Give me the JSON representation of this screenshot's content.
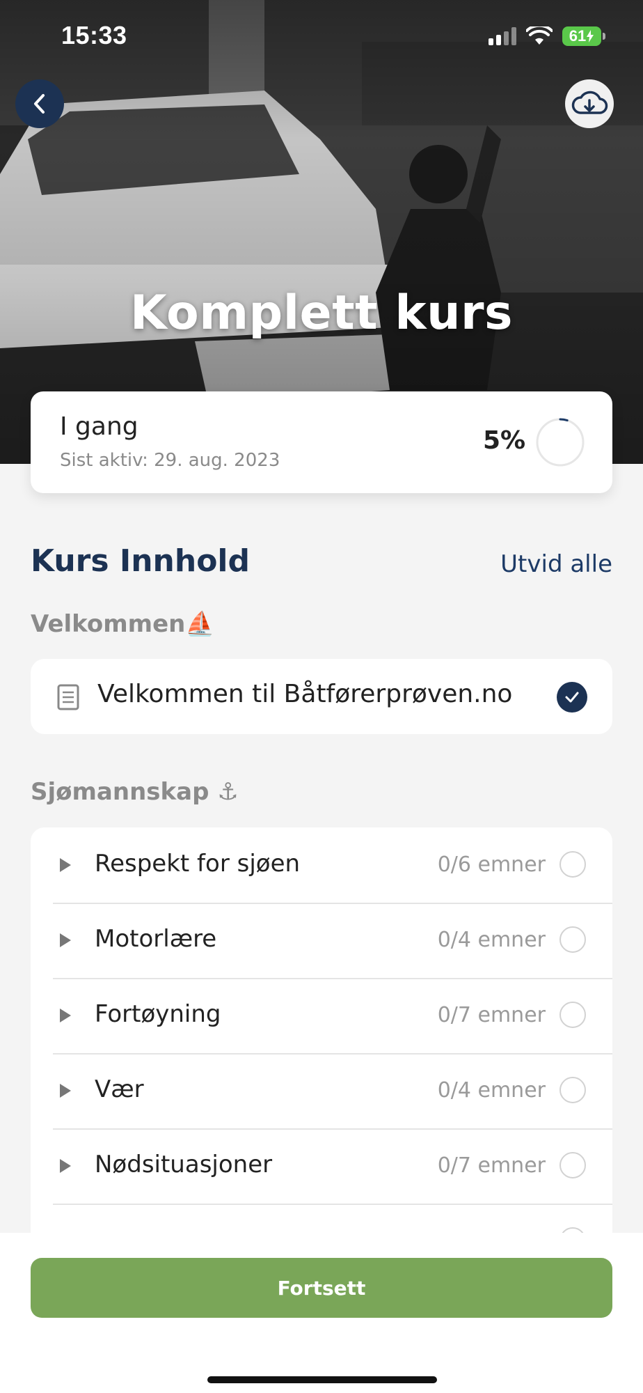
{
  "status_bar": {
    "time": "15:33",
    "battery_level": "61"
  },
  "header": {
    "title": "Komplett kurs",
    "back_icon": "chevron-left-icon",
    "download_icon": "cloud-download-icon"
  },
  "progress": {
    "status": "I gang",
    "last_active": "Sist aktiv: 29. aug. 2023",
    "percent_label": "5%",
    "percent": 5
  },
  "content": {
    "title": "Kurs Innhold",
    "expand_all": "Utvid alle",
    "groups": [
      {
        "title": "Velkommen⛵",
        "items": [
          {
            "label": "Velkommen til Båtførerprøven.no",
            "completed": true
          }
        ]
      },
      {
        "title": "Sjømannskap ⚓",
        "items": [
          {
            "label": "Respekt for sjøen",
            "count": "0/6 emner"
          },
          {
            "label": "Motorlære",
            "count": "0/4 emner"
          },
          {
            "label": "Fortøyning",
            "count": "0/7 emner"
          },
          {
            "label": "Vær",
            "count": "0/4 emner"
          },
          {
            "label": "Nødsituasjoner",
            "count": "0/7 emner"
          }
        ]
      }
    ]
  },
  "footer": {
    "continue_label": "Fortsett"
  },
  "colors": {
    "navy": "#1c3253",
    "green": "#7aa658",
    "background": "#f4f4f4"
  }
}
